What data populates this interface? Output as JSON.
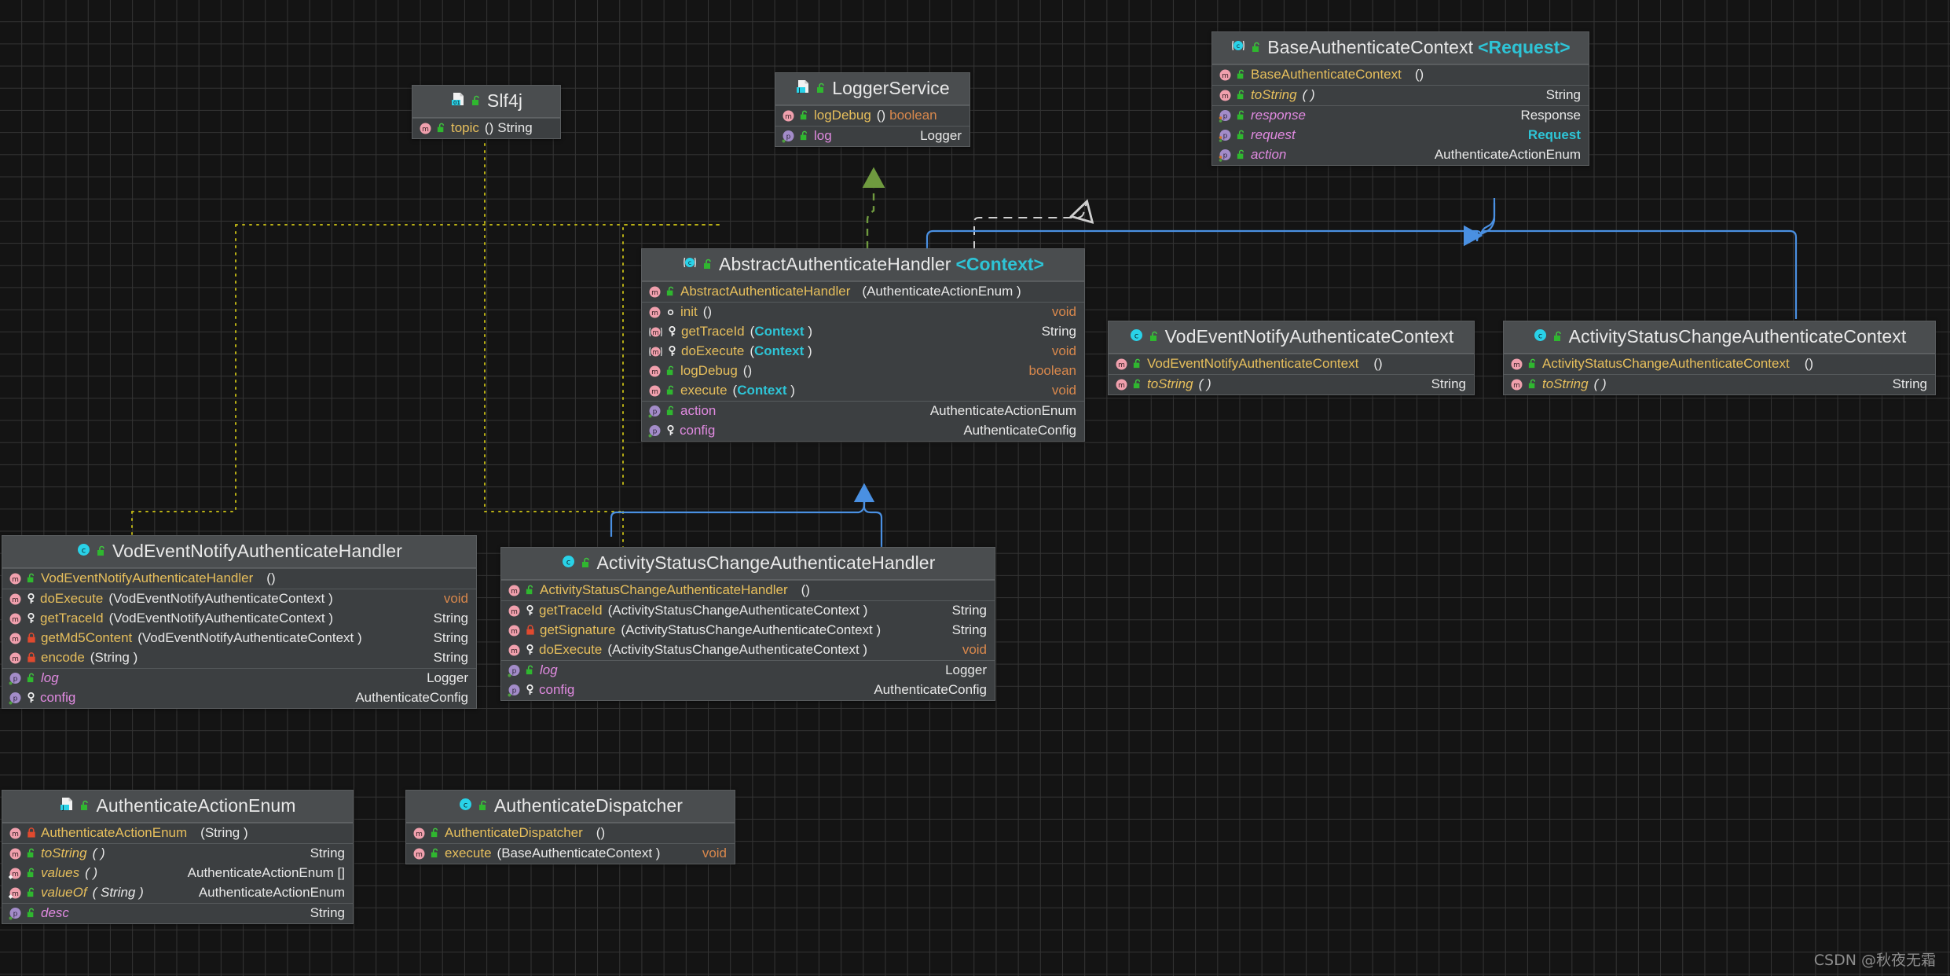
{
  "diagram": {
    "type": "uml-class-diagram",
    "background": "#141414",
    "grid_color": "#343434",
    "watermark": "CSDN @秋夜无霜",
    "colors": {
      "node_body": "#3c3f41",
      "node_header": "#4a4d4f",
      "member_name": "#e7bf5c",
      "property_name": "#e08ae0",
      "generic_type": "#2ec4d6",
      "void_type": "#d9884c",
      "inheritance_edge": "#4a90e2",
      "dependency_edge": "#b9b015",
      "realization_edge": "#cfcfcf",
      "implements_edge": "#6f9a3f"
    }
  },
  "nodes": [
    {
      "id": "slf4j",
      "title": "Slf4j",
      "icon": "annotation-icon",
      "visibility_icon": "unlock-icon",
      "generic": "",
      "sections": [
        {
          "rows": [
            {
              "kind": "method",
              "icon": "method-icon",
              "vis": "unlock-icon",
              "name": "topic",
              "italic": false,
              "sig": "()",
              "ret": "String",
              "ret_kind": "plain"
            }
          ]
        }
      ]
    },
    {
      "id": "loggerservice",
      "title": "LoggerService",
      "icon": "java-interface-file-icon",
      "visibility_icon": "unlock-icon",
      "generic": "",
      "sections": [
        {
          "rows": [
            {
              "kind": "method",
              "icon": "method-icon",
              "vis": "unlock-icon",
              "name": "logDebug",
              "italic": false,
              "sig": "()",
              "ret": "boolean",
              "ret_kind": "bool"
            }
          ]
        },
        {
          "rows": [
            {
              "kind": "prop",
              "icon": "property-icon",
              "vis": "unlock-icon",
              "name": "log",
              "italic": false,
              "sig": "",
              "ret": "Logger",
              "ret_kind": "plain"
            }
          ]
        }
      ]
    },
    {
      "id": "baseauthenticatecontext",
      "title": "BaseAuthenticateContext",
      "icon": "abstract-class-icon",
      "visibility_icon": "unlock-icon",
      "generic": "<Request>",
      "sections": [
        {
          "rows": [
            {
              "kind": "method",
              "icon": "method-icon",
              "vis": "unlock-icon",
              "name": "BaseAuthenticateContext",
              "italic": false,
              "sig": "()",
              "ret": "",
              "ret_kind": "plain"
            }
          ]
        },
        {
          "rows": [
            {
              "kind": "method",
              "icon": "method-icon",
              "vis": "unlock-icon",
              "name": "toString",
              "italic": true,
              "sig": "( )",
              "ret": "String",
              "ret_kind": "plain"
            }
          ]
        },
        {
          "rows": [
            {
              "kind": "prop",
              "icon": "property-icon",
              "vis": "unlock-icon",
              "name": "response",
              "italic": true,
              "sig": "",
              "ret": "Response",
              "ret_kind": "plain"
            },
            {
              "kind": "prop",
              "icon": "property-icon",
              "vis": "unlock-icon",
              "name": "request",
              "italic": true,
              "sig": "",
              "ret": "Request",
              "ret_kind": "gen"
            },
            {
              "kind": "prop",
              "icon": "property-icon",
              "vis": "unlock-icon",
              "name": "action",
              "italic": true,
              "sig": "",
              "ret": "AuthenticateActionEnum",
              "ret_kind": "plain"
            }
          ]
        }
      ]
    },
    {
      "id": "abstractauthenticatehandler",
      "title": "AbstractAuthenticateHandler",
      "icon": "abstract-class-icon",
      "visibility_icon": "unlock-icon",
      "generic": "<Context>",
      "sections": [
        {
          "rows": [
            {
              "kind": "method",
              "icon": "method-icon",
              "vis": "unlock-icon",
              "name": "AbstractAuthenticateHandler",
              "italic": false,
              "sig": "(AuthenticateActionEnum   )",
              "ret": "",
              "ret_kind": "plain"
            }
          ]
        },
        {
          "rows": [
            {
              "kind": "method",
              "icon": "method-icon",
              "vis": "circle-icon",
              "name": "init",
              "italic": false,
              "sig": "()",
              "ret": "void",
              "ret_kind": "void"
            },
            {
              "kind": "method",
              "icon": "abstract-method-icon",
              "vis": "key-icon",
              "name": "getTraceId",
              "italic": false,
              "sig": "(Context )",
              "sig_generic": "Context",
              "ret": "String",
              "ret_kind": "plain"
            },
            {
              "kind": "method",
              "icon": "abstract-method-icon",
              "vis": "key-icon",
              "name": "doExecute",
              "italic": false,
              "sig": "(Context )",
              "sig_generic": "Context",
              "ret": "void",
              "ret_kind": "void"
            },
            {
              "kind": "method",
              "icon": "method-icon",
              "vis": "unlock-icon",
              "name": "logDebug",
              "italic": false,
              "sig": "()",
              "ret": "boolean",
              "ret_kind": "bool"
            },
            {
              "kind": "method",
              "icon": "method-icon",
              "vis": "unlock-icon",
              "name": "execute",
              "italic": false,
              "sig": "(Context )",
              "sig_generic": "Context",
              "ret": "void",
              "ret_kind": "void"
            }
          ]
        },
        {
          "rows": [
            {
              "kind": "prop",
              "icon": "property-icon",
              "vis": "unlock-icon",
              "name": "action",
              "italic": false,
              "sig": "",
              "ret": "AuthenticateActionEnum",
              "ret_kind": "plain"
            },
            {
              "kind": "prop",
              "icon": "property-icon",
              "vis": "key-icon",
              "name": "config",
              "italic": false,
              "sig": "",
              "ret": "AuthenticateConfig",
              "ret_kind": "plain"
            }
          ]
        }
      ]
    },
    {
      "id": "vodeventnotifyauthenticatecontext",
      "title": "VodEventNotifyAuthenticateContext",
      "icon": "class-icon",
      "visibility_icon": "unlock-icon",
      "generic": "",
      "sections": [
        {
          "rows": [
            {
              "kind": "method",
              "icon": "method-icon",
              "vis": "unlock-icon",
              "name": "VodEventNotifyAuthenticateContext",
              "italic": false,
              "sig": "()",
              "ret": "",
              "ret_kind": "plain"
            }
          ]
        },
        {
          "rows": [
            {
              "kind": "method",
              "icon": "method-icon",
              "vis": "unlock-icon",
              "name": "toString",
              "italic": true,
              "sig": "( )",
              "ret": "String",
              "ret_kind": "plain"
            }
          ]
        }
      ]
    },
    {
      "id": "activitystatuschangeauthenticatecontext",
      "title": "ActivityStatusChangeAuthenticateContext",
      "icon": "class-icon",
      "visibility_icon": "unlock-icon",
      "generic": "",
      "sections": [
        {
          "rows": [
            {
              "kind": "method",
              "icon": "method-icon",
              "vis": "unlock-icon",
              "name": "ActivityStatusChangeAuthenticateContext",
              "italic": false,
              "sig": "()",
              "ret": "",
              "ret_kind": "plain"
            }
          ]
        },
        {
          "rows": [
            {
              "kind": "method",
              "icon": "method-icon",
              "vis": "unlock-icon",
              "name": "toString",
              "italic": true,
              "sig": "( )",
              "ret": "String",
              "ret_kind": "plain"
            }
          ]
        }
      ]
    },
    {
      "id": "vodeventnotifyauthenticatehandler",
      "title": "VodEventNotifyAuthenticateHandler",
      "icon": "class-icon",
      "visibility_icon": "unlock-icon",
      "generic": "",
      "sections": [
        {
          "rows": [
            {
              "kind": "method",
              "icon": "method-icon",
              "vis": "unlock-icon",
              "name": "VodEventNotifyAuthenticateHandler",
              "italic": false,
              "sig": "()",
              "ret": "",
              "ret_kind": "plain"
            }
          ]
        },
        {
          "rows": [
            {
              "kind": "method",
              "icon": "method-icon",
              "vis": "key-icon",
              "name": "doExecute",
              "italic": false,
              "sig": "(VodEventNotifyAuthenticateContext    )",
              "ret": "void",
              "ret_kind": "void"
            },
            {
              "kind": "method",
              "icon": "method-icon",
              "vis": "key-icon",
              "name": "getTraceId",
              "italic": false,
              "sig": "(VodEventNotifyAuthenticateContext    )",
              "ret": "String",
              "ret_kind": "plain"
            },
            {
              "kind": "method",
              "icon": "method-icon",
              "vis": "lock-icon",
              "name": "getMd5Content",
              "italic": false,
              "sig": "(VodEventNotifyAuthenticateContext   )",
              "ret": "String",
              "ret_kind": "plain"
            },
            {
              "kind": "method",
              "icon": "method-icon",
              "vis": "lock-icon",
              "name": "encode",
              "italic": false,
              "sig": "(String )",
              "ret": "String",
              "ret_kind": "plain"
            }
          ]
        },
        {
          "rows": [
            {
              "kind": "prop",
              "icon": "property-icon",
              "vis": "unlock-icon",
              "name": "log",
              "italic": true,
              "sig": "",
              "ret": "Logger",
              "ret_kind": "plain"
            },
            {
              "kind": "prop",
              "icon": "property-icon",
              "vis": "key-icon",
              "name": "config",
              "italic": false,
              "sig": "",
              "ret": "AuthenticateConfig",
              "ret_kind": "plain"
            }
          ]
        }
      ]
    },
    {
      "id": "activitystatuschangeauthenticatehandler",
      "title": "ActivityStatusChangeAuthenticateHandler",
      "icon": "class-icon",
      "visibility_icon": "unlock-icon",
      "generic": "",
      "sections": [
        {
          "rows": [
            {
              "kind": "method",
              "icon": "method-icon",
              "vis": "unlock-icon",
              "name": "ActivityStatusChangeAuthenticateHandler",
              "italic": false,
              "sig": "()",
              "ret": "",
              "ret_kind": "plain"
            }
          ]
        },
        {
          "rows": [
            {
              "kind": "method",
              "icon": "method-icon",
              "vis": "key-icon",
              "name": "getTraceId",
              "italic": false,
              "sig": "(ActivityStatusChangeAuthenticateContext    )",
              "ret": "String",
              "ret_kind": "plain"
            },
            {
              "kind": "method",
              "icon": "method-icon",
              "vis": "lock-icon",
              "name": "getSignature",
              "italic": false,
              "sig": "(ActivityStatusChangeAuthenticateContext   )",
              "ret": "String",
              "ret_kind": "plain"
            },
            {
              "kind": "method",
              "icon": "method-icon",
              "vis": "key-icon",
              "name": "doExecute",
              "italic": false,
              "sig": "(ActivityStatusChangeAuthenticateContext    )",
              "ret": "void",
              "ret_kind": "void"
            }
          ]
        },
        {
          "rows": [
            {
              "kind": "prop",
              "icon": "property-icon",
              "vis": "unlock-icon",
              "name": "log",
              "italic": true,
              "sig": "",
              "ret": "Logger",
              "ret_kind": "plain"
            },
            {
              "kind": "prop",
              "icon": "property-icon",
              "vis": "key-icon",
              "name": "config",
              "italic": false,
              "sig": "",
              "ret": "AuthenticateConfig",
              "ret_kind": "plain"
            }
          ]
        }
      ]
    },
    {
      "id": "authenticateactionenum",
      "title": "AuthenticateActionEnum",
      "icon": "enum-file-icon",
      "visibility_icon": "unlock-icon",
      "generic": "",
      "sections": [
        {
          "rows": [
            {
              "kind": "method",
              "icon": "method-icon",
              "vis": "lock-icon",
              "name": "AuthenticateActionEnum",
              "italic": false,
              "sig": "(String )",
              "ret": "",
              "ret_kind": "plain"
            }
          ]
        },
        {
          "rows": [
            {
              "kind": "method",
              "icon": "method-icon",
              "vis": "unlock-icon",
              "name": "toString",
              "italic": true,
              "sig": "( )",
              "ret": "String",
              "ret_kind": "plain"
            },
            {
              "kind": "method",
              "icon": "static-method-icon",
              "vis": "unlock-icon",
              "name": "values",
              "italic": true,
              "sig": "( )",
              "ret": "AuthenticateActionEnum   []",
              "ret_kind": "plain"
            },
            {
              "kind": "method",
              "icon": "static-method-icon",
              "vis": "unlock-icon",
              "name": "valueOf",
              "italic": true,
              "sig": "( String )",
              "sig_italic": true,
              "ret": "AuthenticateActionEnum",
              "ret_kind": "plain"
            }
          ]
        },
        {
          "rows": [
            {
              "kind": "prop",
              "icon": "property-icon",
              "vis": "unlock-icon",
              "name": "desc",
              "italic": true,
              "sig": "",
              "ret": "String",
              "ret_kind": "plain"
            }
          ]
        }
      ]
    },
    {
      "id": "authenticatedispatcher",
      "title": "AuthenticateDispatcher",
      "icon": "class-icon",
      "visibility_icon": "unlock-icon",
      "generic": "",
      "sections": [
        {
          "rows": [
            {
              "kind": "method",
              "icon": "method-icon",
              "vis": "unlock-icon",
              "name": "AuthenticateDispatcher",
              "italic": false,
              "sig": "()",
              "ret": "",
              "ret_kind": "plain"
            }
          ]
        },
        {
          "rows": [
            {
              "kind": "method",
              "icon": "method-icon",
              "vis": "unlock-icon",
              "name": "execute",
              "italic": false,
              "sig": "(BaseAuthenticateContext   )",
              "ret": "void",
              "ret_kind": "void"
            }
          ]
        }
      ]
    }
  ],
  "edges": [
    {
      "from": "abstractauthenticatehandler",
      "to": "loggerservice",
      "kind": "implements",
      "style": "dashed-green"
    },
    {
      "from": "abstractauthenticatehandler",
      "to": "baseauthenticatecontext",
      "kind": "realization",
      "style": "dashed-white"
    },
    {
      "from": "vodeventnotifyauthenticatecontext",
      "to": "baseauthenticatecontext",
      "kind": "inheritance",
      "style": "solid-blue"
    },
    {
      "from": "activitystatuschangeauthenticatecontext",
      "to": "baseauthenticatecontext",
      "kind": "inheritance",
      "style": "solid-blue"
    },
    {
      "from": "vodeventnotifyauthenticatehandler",
      "to": "abstractauthenticatehandler",
      "kind": "inheritance",
      "style": "solid-blue"
    },
    {
      "from": "activitystatuschangeauthenticatehandler",
      "to": "abstractauthenticatehandler",
      "kind": "inheritance",
      "style": "solid-blue"
    },
    {
      "from": "vodeventnotifyauthenticatehandler",
      "to": "slf4j",
      "kind": "dependency",
      "style": "dotted-yellow"
    },
    {
      "from": "activitystatuschangeauthenticatehandler",
      "to": "slf4j",
      "kind": "dependency",
      "style": "dotted-yellow"
    },
    {
      "from": "abstractauthenticatehandler",
      "to": "slf4j",
      "kind": "dependency",
      "style": "dotted-yellow"
    }
  ]
}
